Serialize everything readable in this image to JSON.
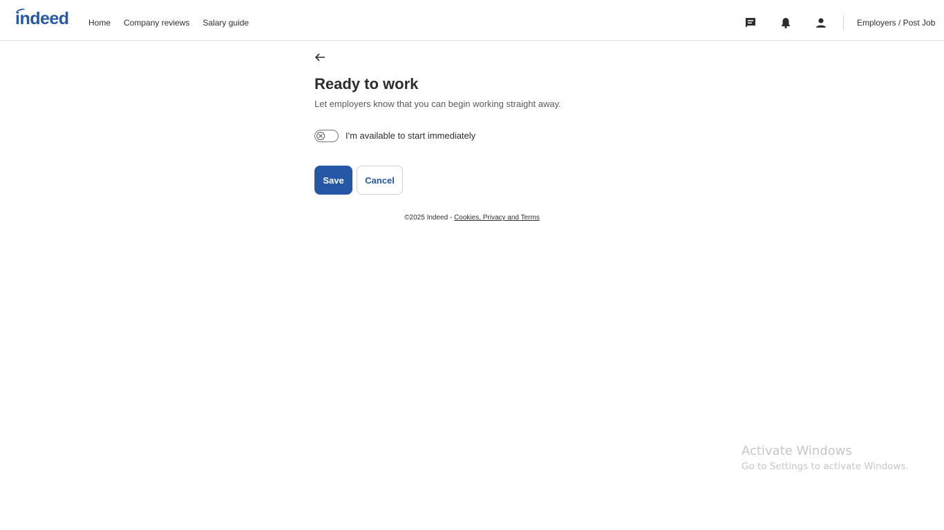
{
  "header": {
    "logo": "indeed",
    "nav": [
      "Home",
      "Company reviews",
      "Salary guide"
    ],
    "employers_link": "Employers / Post Job",
    "icons": [
      "messages-icon",
      "notifications-bell-icon",
      "profile-person-icon"
    ]
  },
  "page": {
    "title": "Ready to work",
    "subtitle": "Let employers know that you can begin working straight away.",
    "toggle_label": "I'm available to start immediately",
    "toggle_on": false,
    "save_label": "Save",
    "cancel_label": "Cancel"
  },
  "footer": {
    "copyright": "©2025 Indeed - ",
    "link": "Cookies, Privacy and Terms"
  },
  "watermark": {
    "line1": "Activate Windows",
    "line2": "Go to Settings to activate Windows."
  },
  "colors": {
    "accent": "#2557a7",
    "text": "#2d2d2d",
    "muted": "#595959"
  }
}
